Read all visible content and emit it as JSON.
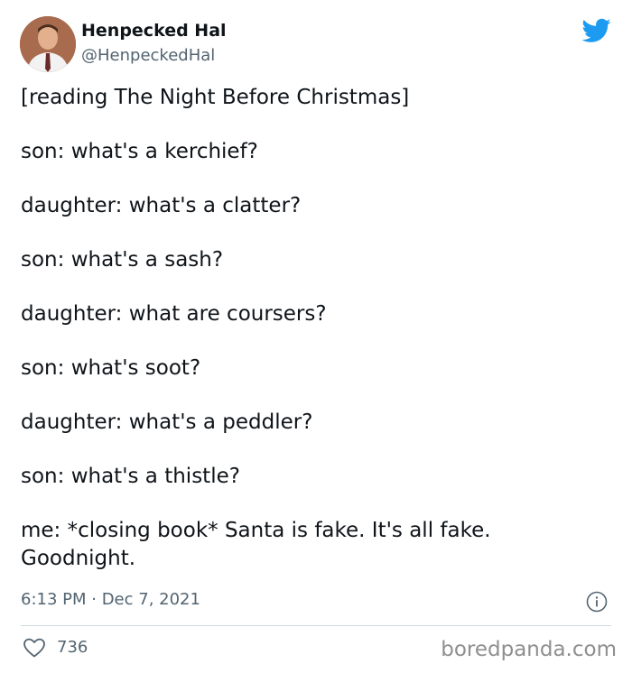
{
  "author": {
    "display_name": "Henpecked Hal",
    "handle": "@HenpeckedHal",
    "avatar_icon": "profile-avatar"
  },
  "brand": {
    "logo_icon": "twitter-bird-icon",
    "accent_color": "#1d9bf0"
  },
  "tweet": {
    "lines": [
      "[reading The Night Before Christmas]",
      "son: what's a kerchief?",
      "daughter: what's a clatter?",
      "son: what's a sash?",
      "daughter: what are coursers?",
      "son: what's soot?",
      "daughter: what's a peddler?",
      "son: what's a thistle?",
      "me: *closing book* Santa is fake. It's all fake.\nGoodnight."
    ],
    "timestamp": "6:13 PM · Dec 7, 2021",
    "info_icon": "info-icon"
  },
  "engagement": {
    "like_icon": "heart-icon",
    "like_count": "736"
  },
  "watermark": "boredpanda.com"
}
